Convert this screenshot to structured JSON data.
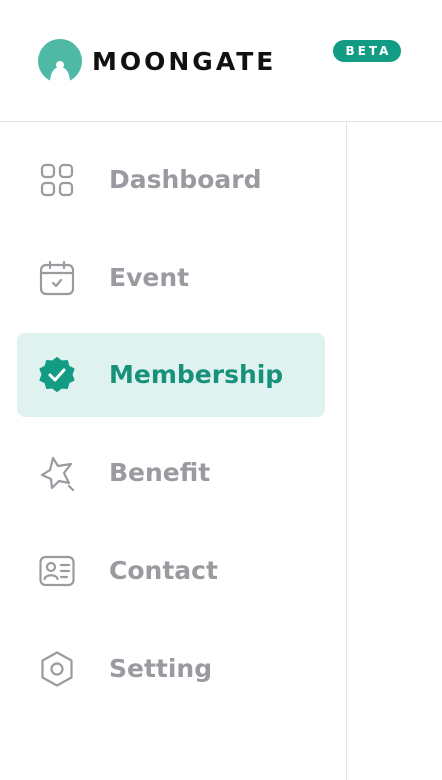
{
  "brand": {
    "name": "MOONGATE",
    "badge": "BETA",
    "accent_color": "#139c84",
    "logo_icon": "moongate-logo-icon"
  },
  "sidebar": {
    "active_index": 2,
    "items": [
      {
        "label": "Dashboard",
        "icon": "dashboard-grid-icon"
      },
      {
        "label": "Event",
        "icon": "calendar-check-icon"
      },
      {
        "label": "Membership",
        "icon": "verified-badge-icon"
      },
      {
        "label": "Benefit",
        "icon": "star-icon"
      },
      {
        "label": "Contact",
        "icon": "contact-card-icon"
      },
      {
        "label": "Setting",
        "icon": "hexagon-settings-icon"
      }
    ]
  },
  "colors": {
    "active_text": "#17917a",
    "active_bg": "#dff2ef",
    "inactive_text": "#9a9ba0"
  }
}
